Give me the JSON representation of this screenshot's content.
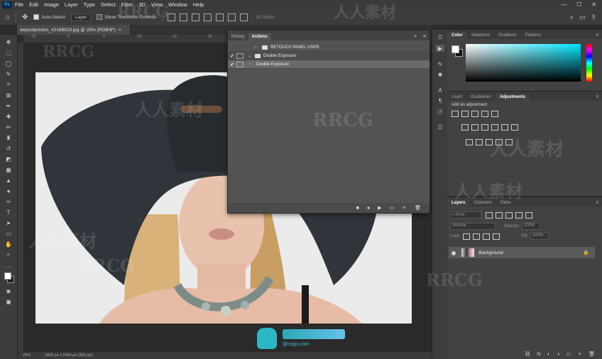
{
  "menu": {
    "logo": "Ps",
    "items": [
      "File",
      "Edit",
      "Image",
      "Layer",
      "Type",
      "Select",
      "Filter",
      "3D",
      "View",
      "Window",
      "Help"
    ],
    "window_controls": [
      "—",
      "☐",
      "✕"
    ]
  },
  "options_bar": {
    "auto_select_label": "Auto-Select",
    "auto_select_value": "Layer",
    "show_transform_label": "Show Transform Controls",
    "mode_3d_label": "3D Mode:"
  },
  "document": {
    "tab_title": "depositphotos_42169819.jpg @ 25% (RGB/8*)",
    "close_glyph": "×",
    "ruler_ticks": [
      "-15",
      "0",
      "5",
      "10",
      "15",
      "20",
      "25",
      "30",
      "35",
      "40",
      "45"
    ],
    "zoom": "25%",
    "doc_info": "3668 px x 2449 px (300 ppi)"
  },
  "actions_panel": {
    "tabs": [
      "History",
      "Actions"
    ],
    "active_tab": "Actions",
    "menu_glyph": "≡",
    "collapse_glyph": "»",
    "rows": [
      {
        "check": "",
        "label": "RETOUCH PANEL USER",
        "indent": 0
      },
      {
        "check": "✔",
        "label": "Double Exposure",
        "indent": 0
      },
      {
        "check": "✔",
        "label": "Double Exposure",
        "indent": 1
      }
    ],
    "footer_buttons": [
      "■",
      "●",
      "▶",
      "▭",
      "＋",
      "🗑"
    ]
  },
  "color_panel": {
    "tabs": [
      "Color",
      "Swatches",
      "Gradients",
      "Patterns"
    ],
    "active_tab": "Color"
  },
  "adjustments_panel": {
    "tabs": [
      "Learn",
      "Guidelines",
      "Adjustments"
    ],
    "active_tab": "Adjustments",
    "add_label": "Add an adjustment"
  },
  "layers_panel": {
    "tabs": [
      "Layers",
      "Channels",
      "Paths"
    ],
    "active_tab": "Layers",
    "kind_label": "Kind",
    "blend_mode": "Normal",
    "opacity_label": "Opacity:",
    "opacity_value": "100%",
    "lock_label": "Lock:",
    "fill_label": "Fill:",
    "fill_value": "100%",
    "layers": [
      {
        "name": "Background",
        "visible": true,
        "locked": true
      }
    ],
    "footer_buttons": [
      "⛓",
      "fx",
      "◐",
      "◑",
      "▭",
      "＋",
      "🗑"
    ]
  },
  "watermarks": {
    "latin": "RRCG",
    "cjk": "人人素材",
    "logo_text": "@ccgo.com"
  },
  "colors": {
    "panel_bg": "#535353",
    "accent_blue": "#31a8ff",
    "app_bg": "#2b2b2b"
  }
}
